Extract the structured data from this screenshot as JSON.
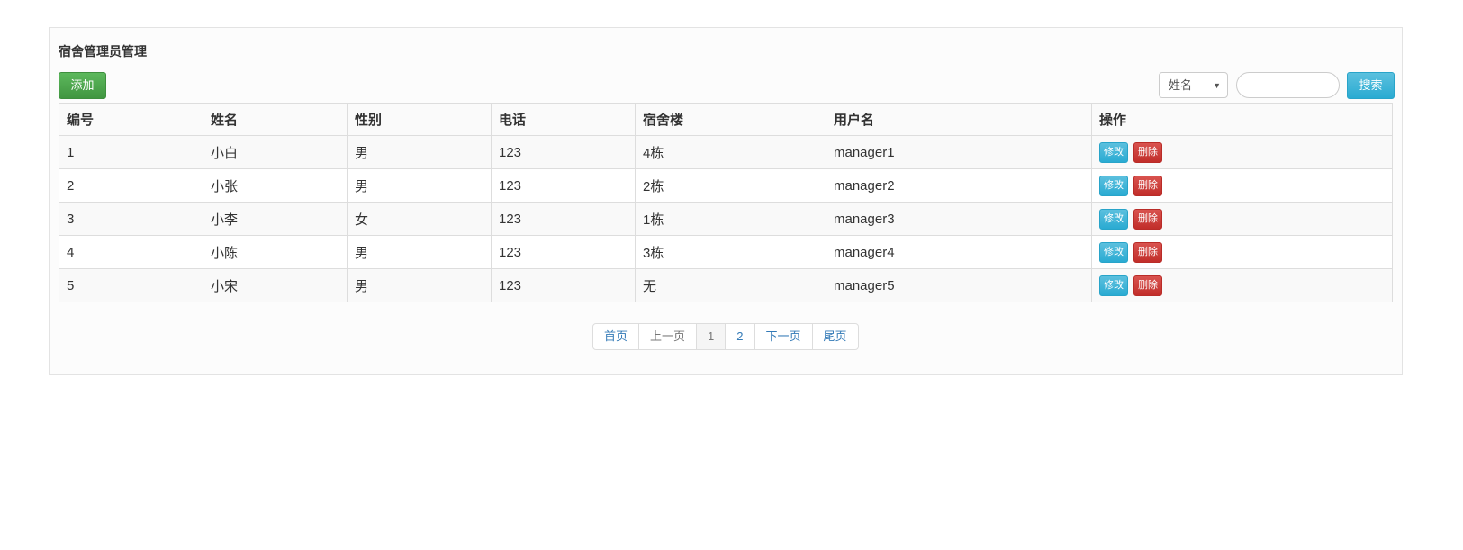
{
  "title": "宿舍管理员管理",
  "add_label": "添加",
  "search": {
    "field": "姓名",
    "value": "",
    "button": "搜索"
  },
  "columns": [
    "编号",
    "姓名",
    "性别",
    "电话",
    "宿舍楼",
    "用户名",
    "操作"
  ],
  "rows": [
    [
      "1",
      "小白",
      "男",
      "123",
      "4栋",
      "manager1"
    ],
    [
      "2",
      "小张",
      "男",
      "123",
      "2栋",
      "manager2"
    ],
    [
      "3",
      "小李",
      "女",
      "123",
      "1栋",
      "manager3"
    ],
    [
      "4",
      "小陈",
      "男",
      "123",
      "3栋",
      "manager4"
    ],
    [
      "5",
      "小宋",
      "男",
      "123",
      "无",
      "manager5"
    ]
  ],
  "actions": {
    "edit": "修改",
    "delete": "删除"
  },
  "pager": [
    "首页",
    "上一页",
    "1",
    "2",
    "下一页",
    "尾页"
  ]
}
